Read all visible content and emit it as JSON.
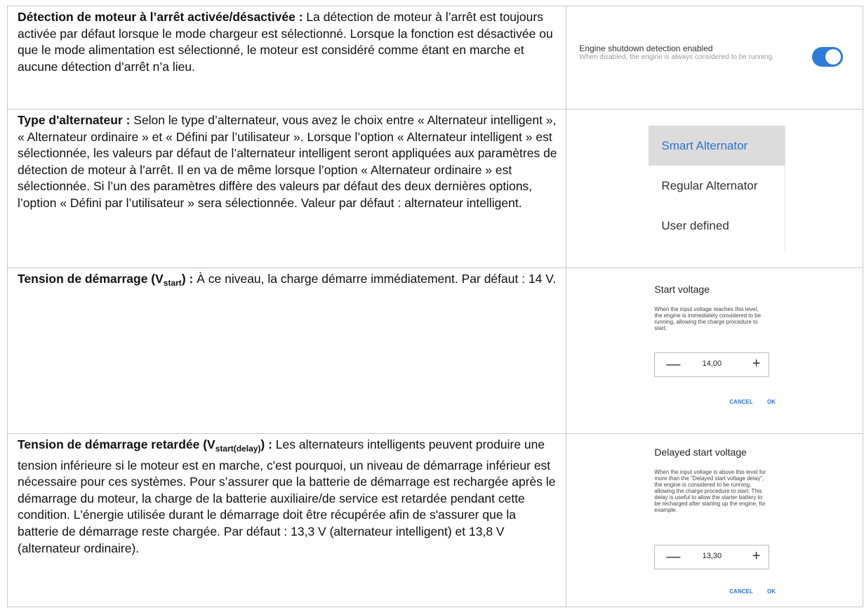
{
  "rows": [
    {
      "label": "Détection de moteur à l’arrêt activée/désactivée :",
      "text": " La détection de moteur à l’arrêt est toujours activée par défaut lorsque le mode chargeur est sélectionné. Lorsque la fonction est désactivée ou que le mode alimentation est sélectionné, le moteur est considéré comme étant en marche et aucune détection d’arrêt n’a lieu."
    },
    {
      "label": "Type d'alternateur :",
      "text": " Selon le type d’alternateur, vous avez le choix entre « Alternateur intelligent », « Alternateur ordinaire » et « Défini par l’utilisateur ». Lorsque l’option « Alternateur intelligent » est sélectionnée, les valeurs par défaut de l’alternateur intelligent seront appliquées aux paramètres de détection de moteur à l’arrêt. Il en va de même lorsque l’option « Alternateur ordinaire » est sélectionnée. Si l’un des paramètres diffère des valeurs par défaut des deux dernières options, l’option « Défini par l’utilisateur » sera sélectionnée. Valeur par défaut : alternateur intelligent."
    },
    {
      "label": "Tension de démarrage (V",
      "label_sub": "start",
      "label_end": ") :",
      "text": " À ce niveau, la charge démarre immédiatement. Par défaut : 14 V."
    },
    {
      "label": "Tension de démarrage retardée (V",
      "label_sub": "start(delay)",
      "label_end": ") :",
      "text": " Les alternateurs intelligents peuvent produire une tension inférieure si le moteur est en marche, c'est pourquoi, un niveau de démarrage inférieur est nécessaire pour ces systèmes. Pour s’assurer que la batterie de démarrage est rechargée après le démarrage du moteur, la charge de la batterie auxiliaire/de service est retardée pendant cette condition. L'énergie utilisée durant le démarrage doit être récupérée afin de s'assurer que la batterie de démarrage reste chargée. Par défaut : 13,3 V (alternateur intelligent) et 13,8 V (alternateur ordinaire)."
    }
  ],
  "engine_setting": {
    "title": "Engine shutdown detection enabled",
    "description": "When disabled, the engine is always considered to be running.",
    "enabled": true,
    "accent": "#2e7bd8"
  },
  "alternator_menu": {
    "items": [
      "Smart Alternator",
      "Regular Alternator",
      "User defined"
    ],
    "selected": "Smart Alternator"
  },
  "start_voltage": {
    "title": "Start voltage",
    "description": "When the input voltage reaches this level, the engine is immediately considered to be running, allowing the charge procedure to start.",
    "value": "14,00",
    "cancel": "CANCEL",
    "ok": "OK"
  },
  "delayed_start_voltage": {
    "title": "Delayed start voltage",
    "description": "When the input voltage is above this level for more than the \"Delayed start voltage delay\", the engine is considered to be running, allowing the charge procedure to start. This delay is useful to allow the starter battery to be recharged after starting up the engine, for example.",
    "value": "13,30",
    "cancel": "CANCEL",
    "ok": "OK"
  }
}
